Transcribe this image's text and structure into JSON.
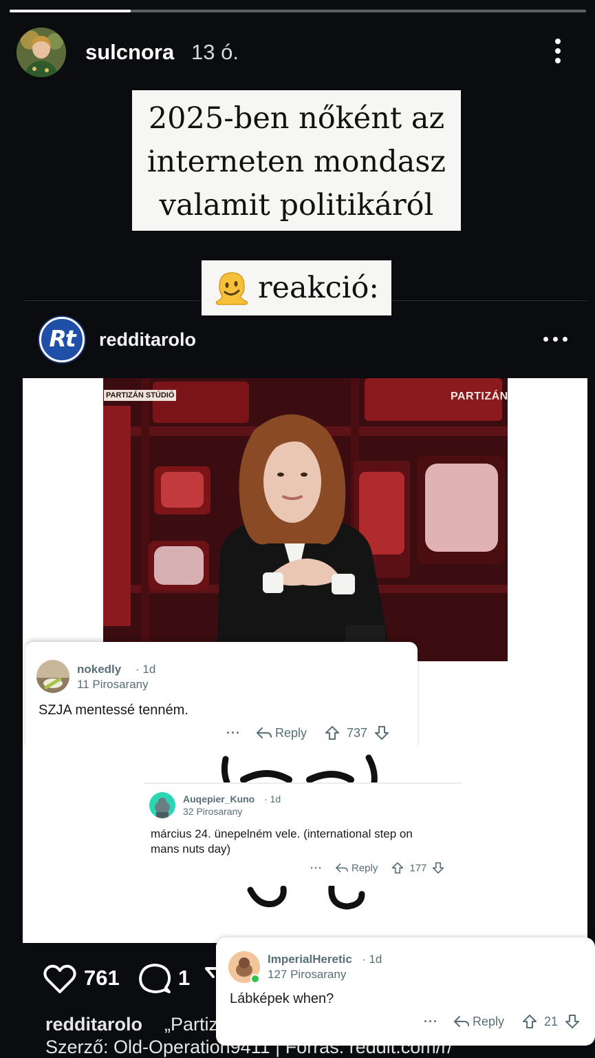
{
  "story": {
    "progress": 0.21,
    "username": "sulcnora",
    "time_ago": "13 ó.",
    "caption_lines": [
      "2025-ben nőként az",
      "interneten mondasz",
      "valamit politikáról"
    ],
    "reaction_label": "reakció:",
    "reaction_emoji": "melting-face-emoji"
  },
  "post": {
    "username": "redditarolo",
    "avatar_text": "Rt",
    "video": {
      "studio_label": "PARTIZÁN STÚDIÓ",
      "brand_label": "PARTIZÁN"
    },
    "likes": "761",
    "comments": "1",
    "caption_user": "redditarolo",
    "caption_text": "„Partiz",
    "source_line": "Szerző: Old-Operation9411 | Forrás: reddit.com/r/"
  },
  "comments": [
    {
      "user": "nokedly",
      "age": "· 1d",
      "flair": "11 Pirosarany",
      "text": "SZJA mentessé tenném.",
      "more": "···",
      "reply": "Reply",
      "votes": "737"
    },
    {
      "user": "Auqepier_Kuno",
      "age": "· 1d",
      "flair": "32 Pirosarany",
      "text_lines": [
        "március 24. ünepelném vele. (international step on",
        "mans nuts day)"
      ],
      "more": "···",
      "reply": "Reply",
      "votes": "177"
    },
    {
      "user": "ImperialHeretic",
      "age": "· 1d",
      "flair": "127 Pirosarany",
      "text": "Lábképek when?",
      "more": "···",
      "reply": "Reply",
      "votes": "21"
    }
  ],
  "colors": {
    "background": "#0b0c10",
    "card": "#ffffff",
    "reddit_meta": "#576f76",
    "avatar_blue": "#1f4fa7",
    "studio_red": "#7a1418",
    "online_green": "#2ec54a"
  },
  "icons": [
    "more-vert-icon",
    "more-horiz-icon",
    "heart-icon",
    "comment-bubble-icon",
    "share-icon",
    "reply-arrow-icon",
    "upvote-icon",
    "downvote-icon"
  ]
}
